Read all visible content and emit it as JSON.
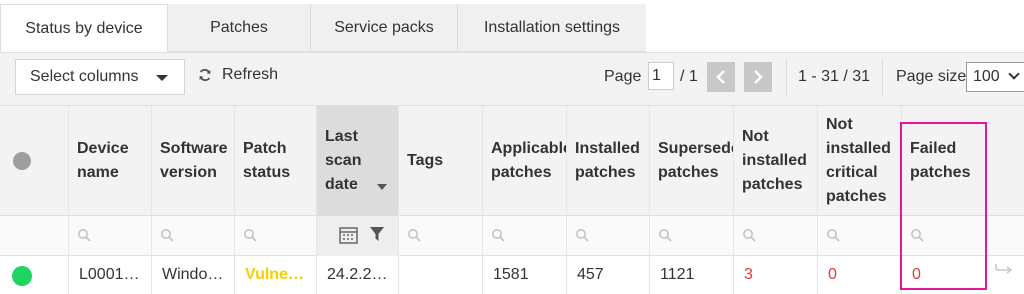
{
  "tabs": [
    {
      "label": "Status by device",
      "active": true
    },
    {
      "label": "Patches"
    },
    {
      "label": "Service packs"
    },
    {
      "label": "Installation settings"
    }
  ],
  "toolbar": {
    "select_columns": "Select columns",
    "refresh": "Refresh",
    "page_label": "Page",
    "page_value": "1",
    "page_of": "/ 1",
    "range": "1 - 31 / 31",
    "page_size_label": "Page size:",
    "page_size_value": "100"
  },
  "columns": [
    {
      "key": "status",
      "label": ""
    },
    {
      "key": "device",
      "label": "Device\nname"
    },
    {
      "key": "version",
      "label": "Software\nversion"
    },
    {
      "key": "patch_status",
      "label": "Patch\nstatus"
    },
    {
      "key": "last_scan",
      "label": "Last\nscan\ndate",
      "sorted": true
    },
    {
      "key": "tags",
      "label": "Tags"
    },
    {
      "key": "applicable",
      "label": "Applicable\npatches"
    },
    {
      "key": "installed",
      "label": "Installed\npatches"
    },
    {
      "key": "superseded",
      "label": "Superseded\npatches"
    },
    {
      "key": "not_installed",
      "label": "Not\ninstalled\npatches"
    },
    {
      "key": "not_installed_critical",
      "label": "Not\ninstalled\ncritical\npatches"
    },
    {
      "key": "failed",
      "label": "Failed\npatches"
    }
  ],
  "row": {
    "device": "L0001…",
    "version": "Windo…",
    "patch_status": "Vulne…",
    "last_scan": "24.2.2…",
    "tags": "",
    "applicable": "1581",
    "installed": "457",
    "superseded": "1121",
    "not_installed": "3",
    "not_installed_critical": "0",
    "failed": "0"
  },
  "colors": {
    "status_online": "#1fd463",
    "highlight": "#e0189a",
    "alert": "#e53935",
    "vulnerable": "#f5d000"
  }
}
